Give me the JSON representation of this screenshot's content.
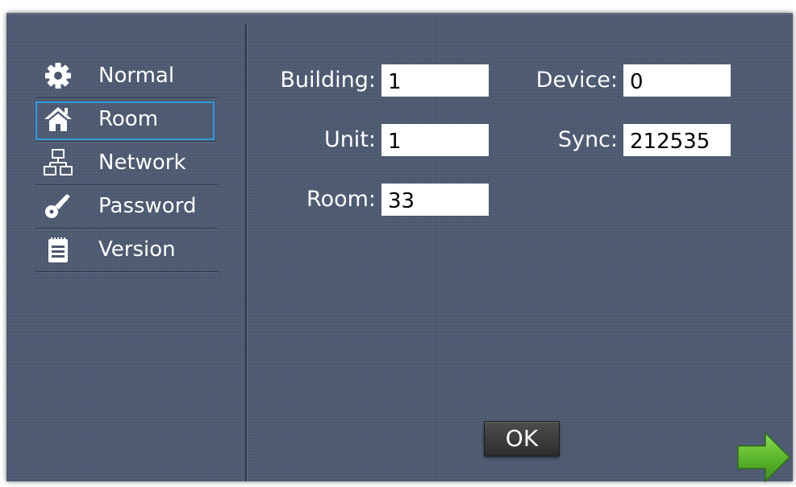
{
  "menu": {
    "items": [
      {
        "label": "Normal",
        "icon": "gear-icon",
        "selected": false
      },
      {
        "label": "Room",
        "icon": "home-icon",
        "selected": true
      },
      {
        "label": "Network",
        "icon": "network-icon",
        "selected": false
      },
      {
        "label": "Password",
        "icon": "key-icon",
        "selected": false
      },
      {
        "label": "Version",
        "icon": "notepad-icon",
        "selected": false
      }
    ]
  },
  "form": {
    "building": {
      "label": "Building:",
      "value": "1"
    },
    "unit": {
      "label": "Unit:",
      "value": "1"
    },
    "room": {
      "label": "Room:",
      "value": "33"
    },
    "device": {
      "label": "Device:",
      "value": "0"
    },
    "sync": {
      "label": "Sync:",
      "value": "212535"
    }
  },
  "buttons": {
    "ok_label": "OK",
    "next_icon": "arrow-right-icon"
  },
  "colors": {
    "panel_bg": "#4b586f",
    "selection_border": "#2e9be0",
    "arrow_green": "#5cb82e"
  }
}
